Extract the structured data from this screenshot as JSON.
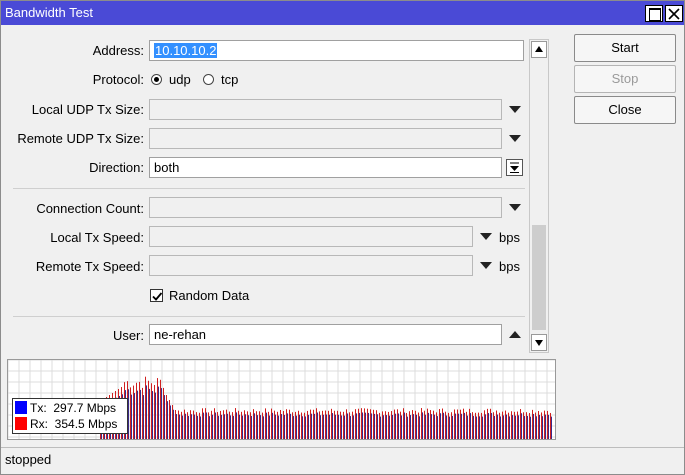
{
  "window": {
    "title": "Bandwidth Test"
  },
  "form": {
    "address": {
      "label": "Address:",
      "value": "10.10.10.2"
    },
    "protocol": {
      "label": "Protocol:",
      "options": [
        "udp",
        "tcp"
      ],
      "selected": "udp"
    },
    "local_udp_tx_size": {
      "label": "Local UDP Tx Size:",
      "value": ""
    },
    "remote_udp_tx_size": {
      "label": "Remote UDP Tx Size:",
      "value": ""
    },
    "direction": {
      "label": "Direction:",
      "value": "both"
    },
    "connection_count": {
      "label": "Connection Count:",
      "value": ""
    },
    "local_tx_speed": {
      "label": "Local Tx Speed:",
      "value": "",
      "unit": "bps"
    },
    "remote_tx_speed": {
      "label": "Remote Tx Speed:",
      "value": "",
      "unit": "bps"
    },
    "random_data": {
      "label": "Random Data",
      "checked": true
    },
    "user": {
      "label": "User:",
      "value": "ne-rehan"
    }
  },
  "buttons": {
    "start": "Start",
    "stop": "Stop",
    "close": "Close"
  },
  "graph": {
    "tx": {
      "label": "Tx:",
      "value": "297.7 Mbps",
      "color": "#0000ff"
    },
    "rx": {
      "label": "Rx:",
      "value": "354.5 Mbps",
      "color": "#ff0000"
    }
  },
  "status": {
    "text": "stopped"
  },
  "colors": {
    "titlebar": "#4a4ad6",
    "selection": "#3390ff",
    "tx_bar": "#3a2a8a",
    "rx_bar": "#d02020"
  }
}
